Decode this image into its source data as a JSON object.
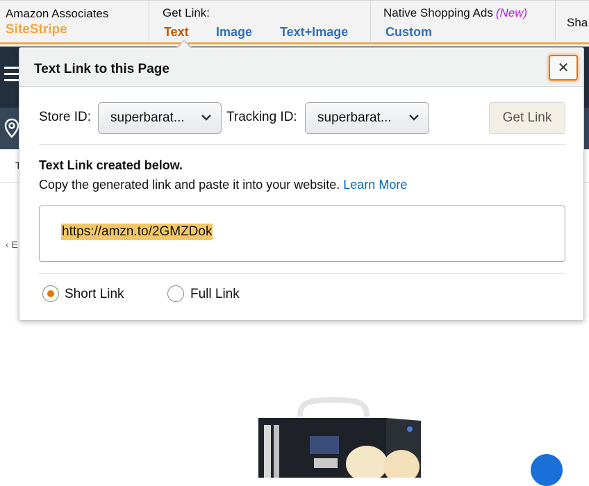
{
  "sitestripe": {
    "brand_line1": "Amazon Associates",
    "brand_line2": "SiteStripe",
    "get_link_label": "Get Link:",
    "link_types": [
      "Text",
      "Image",
      "Text+Image"
    ],
    "native_ads_label": "Native Shopping Ads",
    "native_ads_badge": "(New)",
    "custom_label": "Custom",
    "share_label": "Sha"
  },
  "popup": {
    "title": "Text Link to this Page",
    "close_glyph": "✕",
    "store_id_label": "Store ID:",
    "store_id_value": "superbarat...",
    "tracking_id_label": "Tracking ID:",
    "tracking_id_value": "superbarat...",
    "get_link_button": "Get Link",
    "created_heading": "Text Link created below.",
    "copy_instruction": "Copy the generated link and paste it into your website.",
    "learn_more": "Learn More",
    "generated_link": "https://amzn.to/2GMZDok",
    "radio_short": "Short Link",
    "radio_full": "Full Link",
    "selected_option": "Short Link"
  },
  "background": {
    "back_text": "‹ E",
    "sub_text": "T"
  },
  "colors": {
    "accent": "#f0a742",
    "active_tab": "#c45500",
    "link": "#2f6fbb",
    "new_badge": "#b01fdc",
    "highlight": "#f3c864"
  }
}
